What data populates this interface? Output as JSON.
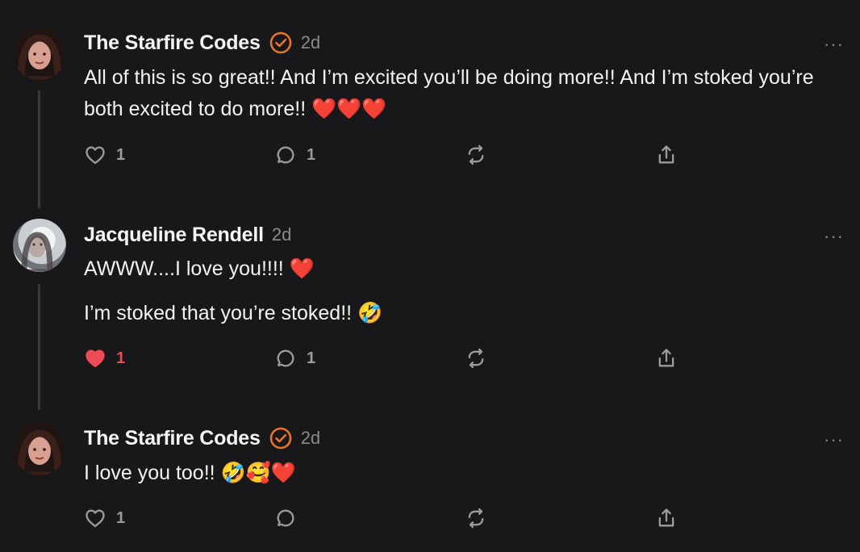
{
  "colors": {
    "background": "#18181a",
    "text": "#f2f2f2",
    "muted": "#8b8b8e",
    "verified": "#e8752a",
    "liked": "#ef4b55"
  },
  "posts": [
    {
      "author": "The Starfire Codes",
      "verified": true,
      "time": "2d",
      "more": "···",
      "paragraphs": [
        "All of this is so great!! And I’m excited you’ll be doing more!! And I’m stoked you’re both excited to do more!! ❤️❤️❤️"
      ],
      "likes": "1",
      "comments": "1",
      "liked": false
    },
    {
      "author": "Jacqueline Rendell",
      "verified": false,
      "time": "2d",
      "more": "···",
      "paragraphs": [
        "AWWW....I love you!!!! ❤️",
        "I’m stoked that you’re stoked!! 🤣"
      ],
      "likes": "1",
      "comments": "1",
      "liked": true
    },
    {
      "author": "The Starfire Codes",
      "verified": true,
      "time": "2d",
      "more": "···",
      "paragraphs": [
        "I love you too!! 🤣🥰❤️"
      ],
      "likes": "1",
      "comments": "",
      "liked": false
    }
  ],
  "icons": [
    "heart-icon",
    "comment-icon",
    "restack-icon",
    "share-icon",
    "verified-icon",
    "more-icon"
  ]
}
